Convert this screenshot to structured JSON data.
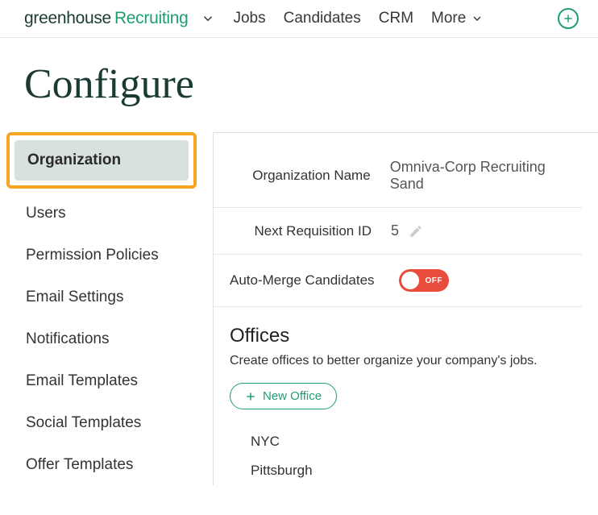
{
  "brand": {
    "greenhouse": "greenhouse",
    "recruiting": "Recruiting"
  },
  "topnav": {
    "items": [
      "Jobs",
      "Candidates",
      "CRM",
      "More"
    ]
  },
  "page": {
    "title": "Configure"
  },
  "sidebar": {
    "items": [
      "Organization",
      "Users",
      "Permission Policies",
      "Email Settings",
      "Notifications",
      "Email Templates",
      "Social Templates",
      "Offer Templates"
    ]
  },
  "org": {
    "name_label": "Organization Name",
    "name_value": "Omniva-Corp Recruiting Sand",
    "req_label": "Next Requisition ID",
    "req_value": "5",
    "automerge_label": "Auto-Merge Candidates",
    "automerge_state": "OFF"
  },
  "offices": {
    "heading": "Offices",
    "sub": "Create offices to better organize your company's jobs.",
    "new_btn": "New Office",
    "list": [
      "NYC",
      "Pittsburgh"
    ]
  }
}
